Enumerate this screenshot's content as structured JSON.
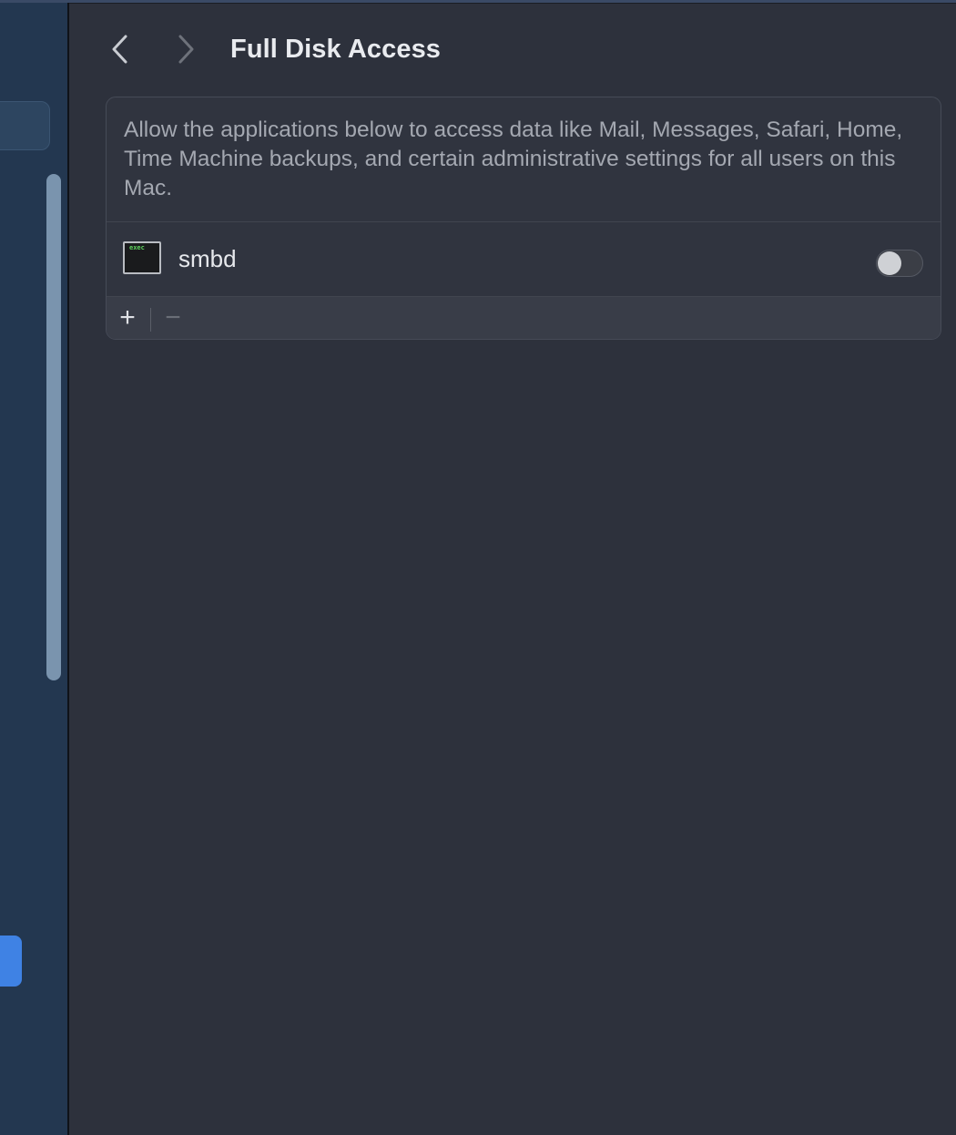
{
  "colors": {
    "window_background": "#2d313c",
    "sidebar_background": "#233750",
    "sidebar_selection": "#3f82e4",
    "toggle_off_track": "#3b3e46",
    "panel_background": "#30343f"
  },
  "header": {
    "back_icon": "chevron-left-icon",
    "forward_icon": "chevron-right-icon",
    "title": "Full Disk Access"
  },
  "panel": {
    "description": "Allow the applications below to access data like Mail, Messages, Safari, Home, Time Machine backups, and certain administrative settings for all users on this Mac.",
    "apps": [
      {
        "name": "smbd",
        "icon": "terminal-exec-icon",
        "icon_text": "exec",
        "enabled": false
      }
    ],
    "footer": {
      "add_label": "+",
      "remove_label": "−"
    }
  }
}
